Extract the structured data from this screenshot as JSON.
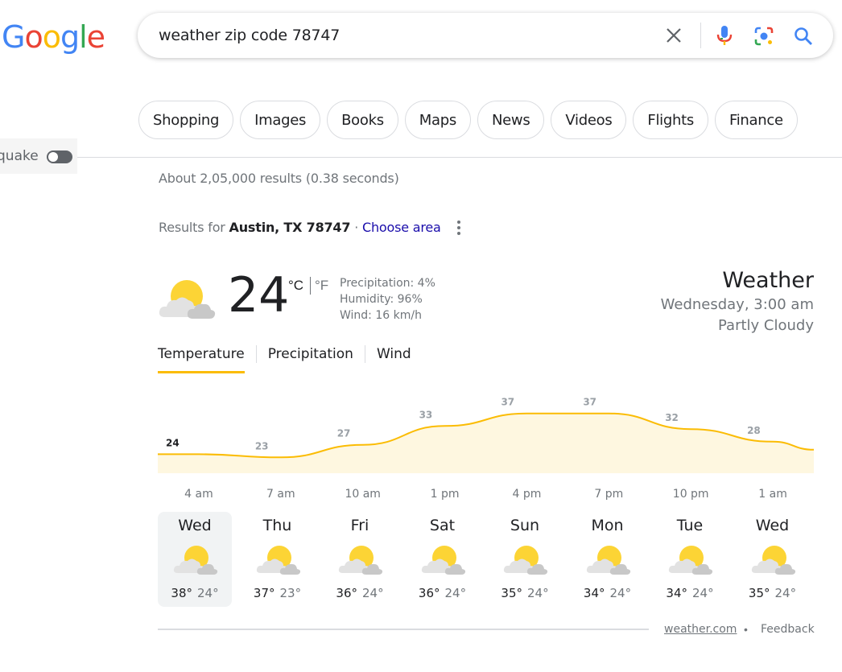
{
  "logo": {
    "letters": [
      "G",
      "o",
      "o",
      "g",
      "l",
      "e"
    ],
    "colors": [
      "#4285f4",
      "#ea4335",
      "#fbbc05",
      "#4285f4",
      "#34a853",
      "#ea4335"
    ]
  },
  "search": {
    "query": "weather zip code 78747"
  },
  "chips": [
    "Shopping",
    "Images",
    "Books",
    "Maps",
    "News",
    "Videos",
    "Flights",
    "Finance"
  ],
  "side_toggle": {
    "label": "quake",
    "on": false
  },
  "result_stats": "About 2,05,000 results (0.38 seconds)",
  "results_for": {
    "prefix": "Results for ",
    "location": "Austin, TX 78747",
    "separator": " · ",
    "choose_area": "Choose area"
  },
  "weather": {
    "current_temp": "24",
    "unit_c": "°C",
    "unit_f": "°F",
    "precipitation": "Precipitation: 4%",
    "humidity": "Humidity: 96%",
    "wind": "Wind: 16 km/h",
    "title": "Weather",
    "time": "Wednesday, 3:00 am",
    "condition": "Partly Cloudy",
    "tabs": [
      "Temperature",
      "Precipitation",
      "Wind"
    ],
    "active_tab": 0
  },
  "chart_data": {
    "type": "area",
    "x": [
      "4 am",
      "7 am",
      "10 am",
      "1 pm",
      "4 pm",
      "7 pm",
      "10 pm",
      "1 am"
    ],
    "values": [
      24,
      23,
      27,
      33,
      37,
      37,
      32,
      28
    ],
    "highlight_index": 0,
    "fill_color": "#fef7e0",
    "line_color": "#fbbc04"
  },
  "forecast": [
    {
      "day": "Wed",
      "high": "38°",
      "low": "24°",
      "icon": "partly-cloudy-icon"
    },
    {
      "day": "Thu",
      "high": "37°",
      "low": "23°",
      "icon": "partly-cloudy-icon"
    },
    {
      "day": "Fri",
      "high": "36°",
      "low": "24°",
      "icon": "partly-cloudy-icon"
    },
    {
      "day": "Sat",
      "high": "36°",
      "low": "24°",
      "icon": "partly-cloudy-icon"
    },
    {
      "day": "Sun",
      "high": "35°",
      "low": "24°",
      "icon": "partly-cloudy-icon"
    },
    {
      "day": "Mon",
      "high": "34°",
      "low": "24°",
      "icon": "partly-cloudy-icon"
    },
    {
      "day": "Tue",
      "high": "34°",
      "low": "24°",
      "icon": "partly-cloudy-icon"
    },
    {
      "day": "Wed",
      "high": "35°",
      "low": "24°",
      "icon": "partly-cloudy-icon"
    }
  ],
  "selected_day": 0,
  "footer": {
    "source": "weather.com",
    "dot": "•",
    "feedback": "Feedback"
  }
}
